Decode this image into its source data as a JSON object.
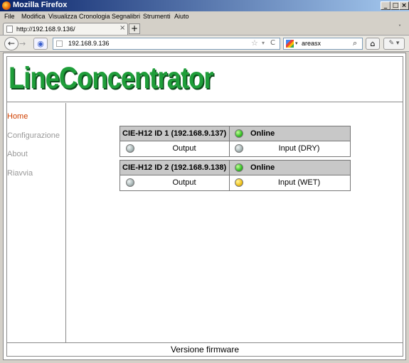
{
  "window": {
    "title": "Mozilla Firefox",
    "min": "_",
    "max": "□",
    "close": "×"
  },
  "menu": [
    "File",
    "Modifica",
    "Visualizza",
    "Cronologia",
    "Segnalibri",
    "Strumenti",
    "Aiuto"
  ],
  "tab": {
    "label": "http://192.168.9.136/",
    "close": "×",
    "new_tab": "+",
    "list": "˅"
  },
  "nav": {
    "back": "←",
    "forward": "→",
    "url": "192.168.9.136",
    "star": "☆",
    "drop": "▾",
    "reload": "C",
    "search_engine_drop": "▾",
    "search_text": "areasx",
    "search_icon": "⌕",
    "home": "⌂",
    "addon": "✎ ▾"
  },
  "page": {
    "logo": "LineConcentrator",
    "sidebar": [
      "Home",
      "Configurazione",
      "About",
      "Riavvia"
    ],
    "devices": [
      {
        "title": "CIE-H12 ID 1 (192.168.9.137)",
        "status": "Online",
        "status_led": "green",
        "output_label": "Output",
        "output_led": "grey",
        "input_label": "Input (DRY)",
        "input_led": "grey"
      },
      {
        "title": "CIE-H12 ID 2 (192.168.9.138)",
        "status": "Online",
        "status_led": "green",
        "output_label": "Output",
        "output_led": "grey",
        "input_label": "Input (WET)",
        "input_led": "yellow"
      }
    ],
    "footer": "Versione firmware"
  },
  "colors": {
    "logo": "#1f9e3a",
    "active_nav": "#d04000",
    "inactive_nav": "#999999",
    "header_row": "#c8c8c8"
  }
}
